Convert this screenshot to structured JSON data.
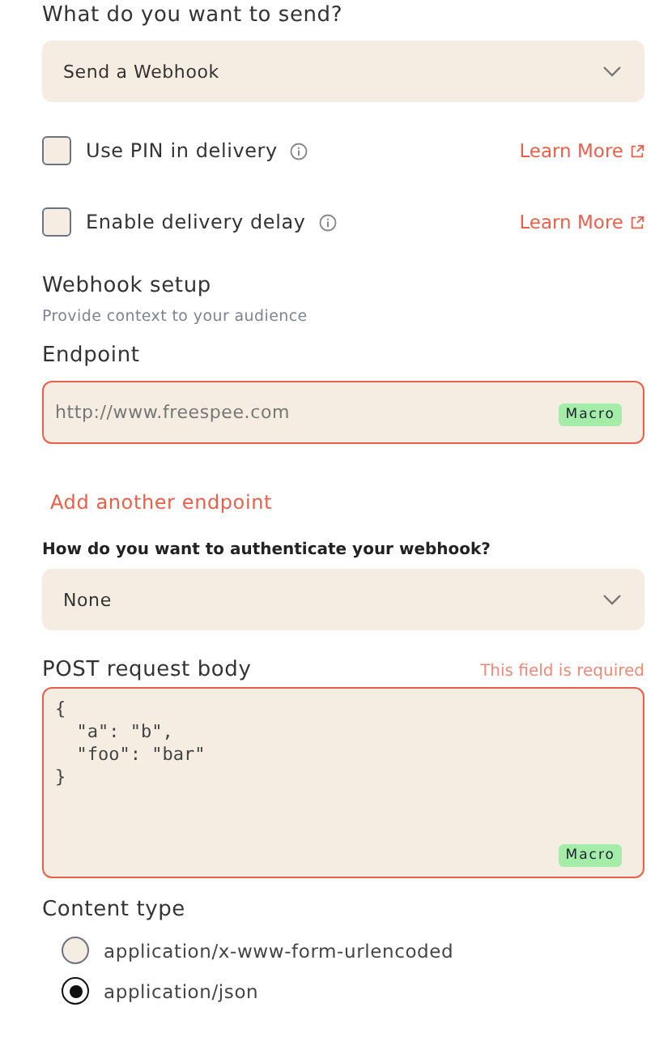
{
  "send_question": {
    "label": "What do you want to send?",
    "select": {
      "value": "Send a Webhook"
    }
  },
  "options": [
    {
      "label": "Use PIN in delivery",
      "checked": false,
      "link": "Learn More"
    },
    {
      "label": "Enable delivery delay",
      "checked": false,
      "link": "Learn More"
    }
  ],
  "webhook_setup": {
    "title": "Webhook setup",
    "subtitle": "Provide context to your audience"
  },
  "endpoint": {
    "label": "Endpoint",
    "placeholder": "http://www.freespee.com",
    "badge": "Macro",
    "error": true
  },
  "add_endpoint": "Add another endpoint",
  "auth": {
    "label": "How do you want to authenticate your webhook?",
    "select": {
      "value": "None"
    }
  },
  "request_body": {
    "label": "POST request body",
    "error_text": "This field is required",
    "value": "{\n  \"a\": \"b\",\n  \"foo\": \"bar\"\n}",
    "badge": "Macro",
    "error": true
  },
  "content_type": {
    "label": "Content type",
    "options": [
      {
        "label": "application/x-www-form-urlencoded",
        "selected": false
      },
      {
        "label": "application/json",
        "selected": true
      }
    ]
  }
}
